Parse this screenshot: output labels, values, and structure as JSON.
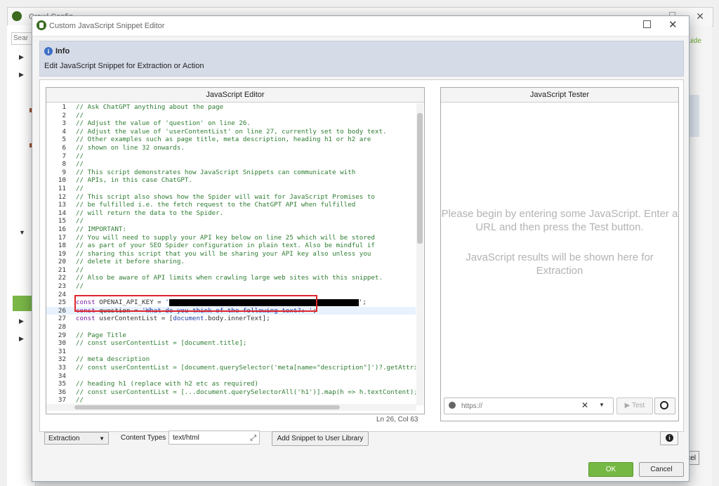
{
  "background_app": {
    "title": "Crawl Config",
    "search_placeholder": "Sear",
    "guide_link": "uide",
    "cancel_fragment": "ncel"
  },
  "dialog": {
    "title": "Custom JavaScript Snippet Editor",
    "info_title": "Info",
    "info_description": "Edit JavaScript Snippet for Extraction or Action"
  },
  "editor": {
    "header": "JavaScript Editor",
    "status": "Ln 26, Col 63",
    "lines": [
      {
        "n": "1",
        "t": "// Ask ChatGPT anything about the page"
      },
      {
        "n": "2",
        "t": "//"
      },
      {
        "n": "3",
        "t": "// Adjust the value of 'question' on line 26."
      },
      {
        "n": "4",
        "t": "// Adjust the value of 'userContentList' on line 27, currently set to body text."
      },
      {
        "n": "5",
        "t": "// Other examples such as page title, meta description, heading h1 or h2 are"
      },
      {
        "n": "6",
        "t": "// shown on line 32 onwards."
      },
      {
        "n": "7",
        "t": "//"
      },
      {
        "n": "8",
        "t": "//"
      },
      {
        "n": "9",
        "t": "// This script demonstrates how JavaScript Snippets can communicate with"
      },
      {
        "n": "10",
        "t": "// APIs, in this case ChatGPT."
      },
      {
        "n": "11",
        "t": "//"
      },
      {
        "n": "12",
        "t": "// This script also shows how the Spider will wait for JavaScript Promises to"
      },
      {
        "n": "13",
        "t": "// be fulfilled i.e. the fetch request to the ChatGPT API when fulfilled"
      },
      {
        "n": "14",
        "t": "// will return the data to the Spider."
      },
      {
        "n": "15",
        "t": "//"
      },
      {
        "n": "16",
        "t": "// IMPORTANT:"
      },
      {
        "n": "17",
        "t": "// You will need to supply your API key below on line 25 which will be stored"
      },
      {
        "n": "18",
        "t": "// as part of your SEO Spider configuration in plain text. Also be mindful if"
      },
      {
        "n": "19",
        "t": "// sharing this script that you will be sharing your API key also unless you"
      },
      {
        "n": "20",
        "t": "// delete it before sharing."
      },
      {
        "n": "21",
        "t": "//"
      },
      {
        "n": "22",
        "t": "// Also be aware of API limits when crawling large web sites with this snippet."
      },
      {
        "n": "23",
        "t": "//"
      },
      {
        "n": "24",
        "t": ""
      },
      {
        "n": "25",
        "t": ""
      },
      {
        "n": "26",
        "t": ""
      },
      {
        "n": "27",
        "t": ""
      },
      {
        "n": "28",
        "t": ""
      },
      {
        "n": "29",
        "t": "// Page Title"
      },
      {
        "n": "30",
        "t": "// const userContentList = [document.title];"
      },
      {
        "n": "31",
        "t": ""
      },
      {
        "n": "32",
        "t": "// meta description"
      },
      {
        "n": "33",
        "t": "// const userContentList = [document.querySelector('meta[name=\"description\"]')?.getAttri"
      },
      {
        "n": "34",
        "t": ""
      },
      {
        "n": "35",
        "t": "// heading h1 (replace with h2 etc as required)"
      },
      {
        "n": "36",
        "t": "// const userContentList = [...document.querySelectorAll('h1')].map(h => h.textContent);"
      },
      {
        "n": "37",
        "t": "//"
      }
    ],
    "line25": {
      "kw": "const",
      "rest": " OPENAI_API_KEY = ",
      "str": "'",
      "end": "';"
    },
    "line26": {
      "kw": "const",
      "rest": " question = ",
      "str": "'What do you think of the following text?: '",
      "end": ";"
    },
    "line27": {
      "kw": "const",
      "rest": " userContentList = [",
      "ident": "document",
      "end": ".body.innerText];"
    }
  },
  "tester": {
    "header": "JavaScript Tester",
    "message1": "Please begin by entering some JavaScript. Enter a URL and then press the Test button.",
    "message2": "JavaScript results will be shown here for Extraction",
    "url_placeholder": "https://",
    "test_label": "Test"
  },
  "bottom": {
    "mode_select": "Extraction",
    "content_types_label": "Content Types",
    "content_types_value": "text/html",
    "add_snippet_label": "Add Snippet to User Library",
    "ok_label": "OK",
    "cancel_label": "Cancel"
  },
  "colors": {
    "ok_green": "#75b843",
    "highlight_red": "#e0242c",
    "info_bg": "#d6dbe8",
    "comment_green": "#2e7d32"
  }
}
